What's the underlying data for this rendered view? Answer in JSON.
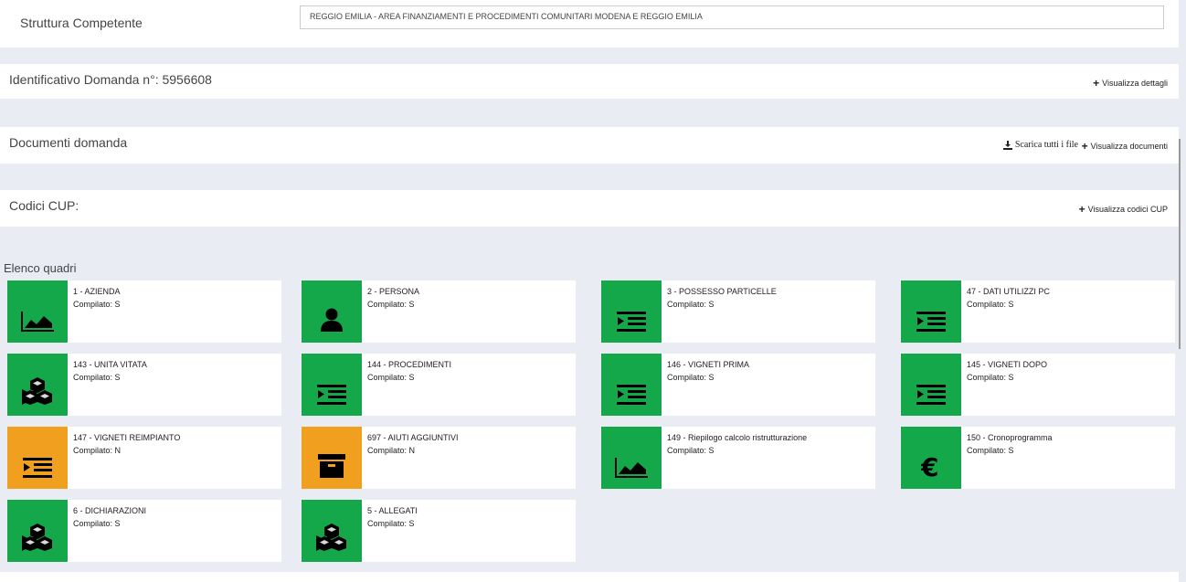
{
  "top": {
    "label": "Struttura Competente",
    "value": "REGGIO EMILIA - AREA FINANZIAMENTI E PROCEDIMENTI COMUNITARI MODENA E REGGIO EMILIA"
  },
  "identificativo": {
    "title": "Identificativo Domanda n°: 5956608",
    "action": "Visualizza dettagli"
  },
  "documenti": {
    "title": "Documenti domanda",
    "download": "Scarica tutti i file",
    "action": "Visualizza documenti"
  },
  "cup": {
    "title": "Codici CUP:",
    "action": "Visualizza codici CUP"
  },
  "elenco": {
    "title": "Elenco quadri"
  },
  "cards": [
    {
      "title": "1 - AZIENDA",
      "status": "Compilato: S",
      "icon": "area-chart-icon",
      "color": "#14a84a"
    },
    {
      "title": "2 - PERSONA",
      "status": "Compilato: S",
      "icon": "user-icon",
      "color": "#14a84a"
    },
    {
      "title": "3 - POSSESSO PARTICELLE",
      "status": "Compilato: S",
      "icon": "indent-icon",
      "color": "#14a84a"
    },
    {
      "title": "47 - DATI UTILIZZI PC",
      "status": "Compilato: S",
      "icon": "indent-icon",
      "color": "#14a84a"
    },
    {
      "title": "143 - UNITA VITATA",
      "status": "Compilato: S",
      "icon": "cubes-icon",
      "color": "#14a84a"
    },
    {
      "title": "144 - PROCEDIMENTI",
      "status": "Compilato: S",
      "icon": "indent-icon",
      "color": "#14a84a"
    },
    {
      "title": "146 - VIGNETI PRIMA",
      "status": "Compilato: S",
      "icon": "indent-icon",
      "color": "#14a84a"
    },
    {
      "title": "145 - VIGNETI DOPO",
      "status": "Compilato: S",
      "icon": "indent-icon",
      "color": "#14a84a"
    },
    {
      "title": "147 - VIGNETI REIMPIANTO",
      "status": "Compilato: N",
      "icon": "indent-icon",
      "color": "#f0a01e"
    },
    {
      "title": "697 - AIUTI AGGIUNTIVI",
      "status": "Compilato: N",
      "icon": "archive-icon",
      "color": "#f0a01e"
    },
    {
      "title": "149 - Riepilogo calcolo ristrutturazione",
      "status": "Compilato: S",
      "icon": "area-chart-icon",
      "color": "#14a84a"
    },
    {
      "title": "150 - Cronoprogramma",
      "status": "Compilato: S",
      "icon": "euro-icon",
      "color": "#14a84a"
    },
    {
      "title": "6 - DICHIARAZIONI",
      "status": "Compilato: S",
      "icon": "cubes-icon",
      "color": "#14a84a"
    },
    {
      "title": "5 - ALLEGATI",
      "status": "Compilato: S",
      "icon": "cubes-icon",
      "color": "#14a84a"
    }
  ]
}
